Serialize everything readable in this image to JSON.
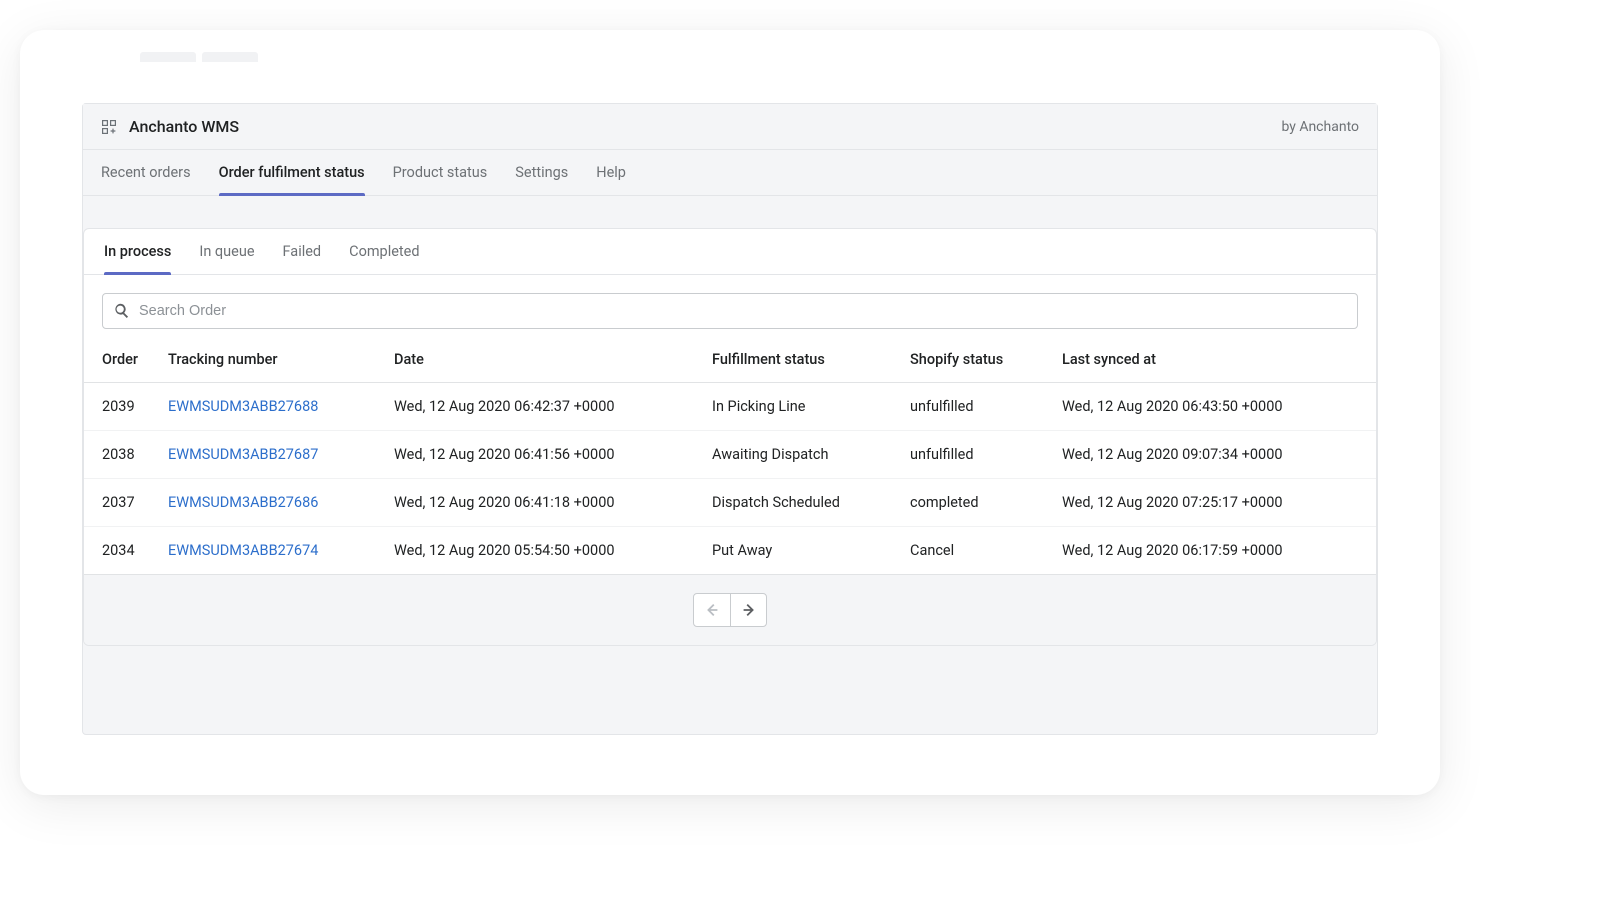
{
  "header": {
    "app_title": "Anchanto WMS",
    "by_text": "by Anchanto"
  },
  "top_tabs": [
    {
      "label": "Recent orders",
      "active": false
    },
    {
      "label": "Order fulfilment status",
      "active": true
    },
    {
      "label": "Product status",
      "active": false
    },
    {
      "label": "Settings",
      "active": false
    },
    {
      "label": "Help",
      "active": false
    }
  ],
  "sub_tabs": [
    {
      "label": "In process",
      "active": true
    },
    {
      "label": "In queue",
      "active": false
    },
    {
      "label": "Failed",
      "active": false
    },
    {
      "label": "Completed",
      "active": false
    }
  ],
  "search": {
    "placeholder": "Search Order"
  },
  "table": {
    "columns": [
      "Order",
      "Tracking number",
      "Date",
      "Fulfillment status",
      "Shopify status",
      "Last synced at"
    ],
    "rows": [
      {
        "order": "2039",
        "tracking": "EWMSUDM3ABB27688",
        "date": "Wed, 12 Aug 2020 06:42:37 +0000",
        "fulfillment": "In Picking Line",
        "shopify": "unfulfilled",
        "synced": "Wed, 12 Aug 2020 06:43:50 +0000"
      },
      {
        "order": "2038",
        "tracking": "EWMSUDM3ABB27687",
        "date": "Wed, 12 Aug 2020 06:41:56 +0000",
        "fulfillment": "Awaiting Dispatch",
        "shopify": "unfulfilled",
        "synced": "Wed, 12 Aug 2020 09:07:34 +0000"
      },
      {
        "order": "2037",
        "tracking": "EWMSUDM3ABB27686",
        "date": "Wed, 12 Aug 2020 06:41:18 +0000",
        "fulfillment": "Dispatch Scheduled",
        "shopify": "completed",
        "synced": "Wed, 12 Aug 2020 07:25:17 +0000"
      },
      {
        "order": "2034",
        "tracking": "EWMSUDM3ABB27674",
        "date": "Wed, 12 Aug 2020 05:54:50 +0000",
        "fulfillment": "Put Away",
        "shopify": "Cancel",
        "synced": "Wed, 12 Aug 2020 06:17:59 +0000"
      }
    ]
  }
}
